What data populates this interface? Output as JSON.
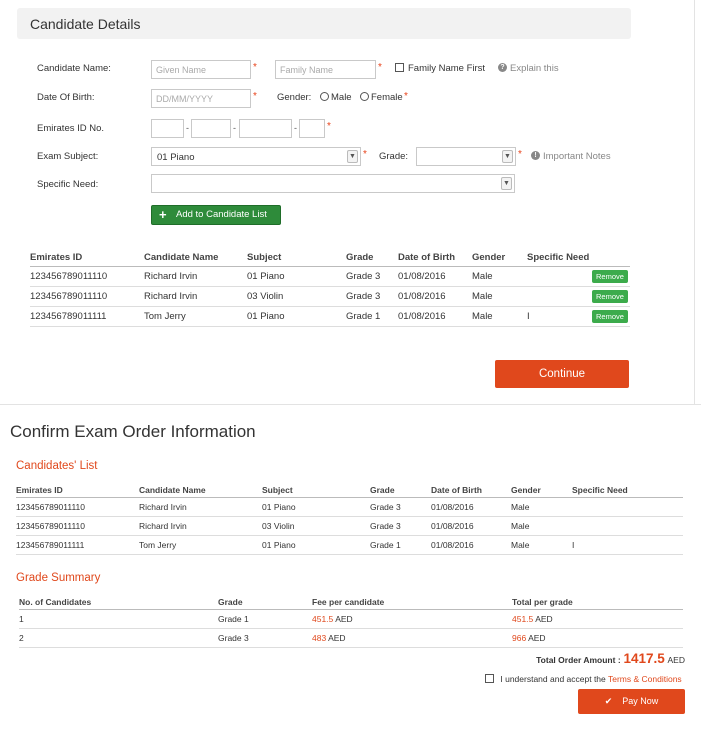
{
  "candidate_details": {
    "title": "Candidate Details",
    "name_label": "Candidate Name:",
    "given_name_placeholder": "Given Name",
    "family_name_placeholder": "Family Name",
    "family_name_first_label": "Family Name First",
    "explain_label": "Explain this",
    "dob_label": "Date Of Birth:",
    "dob_placeholder": "DD/MM/YYYY",
    "gender_label": "Gender:",
    "gender_male": "Male",
    "gender_female": "Female",
    "emirates_label": "Emirates ID No.",
    "subject_label": "Exam Subject:",
    "subject_value": "01 Piano",
    "grade_label": "Grade:",
    "grade_value": "",
    "important_notes_label": "Important Notes",
    "specific_need_label": "Specific Need:",
    "specific_need_value": "",
    "add_button": "Add to Candidate List",
    "required_mark": "*",
    "dash": "-",
    "remove_label": "Remove",
    "continue_button": "Continue"
  },
  "candidate_table": {
    "headers": [
      "Emirates ID",
      "Candidate Name",
      "Subject",
      "Grade",
      "Date of Birth",
      "Gender",
      "Specific Need"
    ],
    "rows": [
      [
        "123456789011110",
        "Richard Irvin",
        "01 Piano",
        "Grade 3",
        "01/08/2016",
        "Male",
        ""
      ],
      [
        "123456789011110",
        "Richard Irvin",
        "03 Violin",
        "Grade 3",
        "01/08/2016",
        "Male",
        ""
      ],
      [
        "123456789011111",
        "Tom Jerry",
        "01 Piano",
        "Grade 1",
        "01/08/2016",
        "Male",
        "I"
      ]
    ]
  },
  "confirm": {
    "title": "Confirm Exam Order Information",
    "candidates_list_title": "Candidates' List",
    "grade_summary_title": "Grade Summary",
    "summary_headers": [
      "No. of Candidates",
      "Grade",
      "Fee per candidate",
      "Total per grade"
    ],
    "summary_rows": [
      {
        "count": "1",
        "grade": "Grade 1",
        "fee": "451.5",
        "total": "451.5"
      },
      {
        "count": "2",
        "grade": "Grade 3",
        "fee": "483",
        "total": "966"
      }
    ],
    "currency": "AED",
    "total_label": "Total Order Amount :",
    "total_value": "1417.5",
    "terms_prefix": "I understand and accept the",
    "terms_link": "Terms & Conditions",
    "pay_button": "Pay Now"
  },
  "colors": {
    "accent": "#e0481c",
    "add_button": "#2e8b3a",
    "remove_button": "#3cab4c"
  }
}
